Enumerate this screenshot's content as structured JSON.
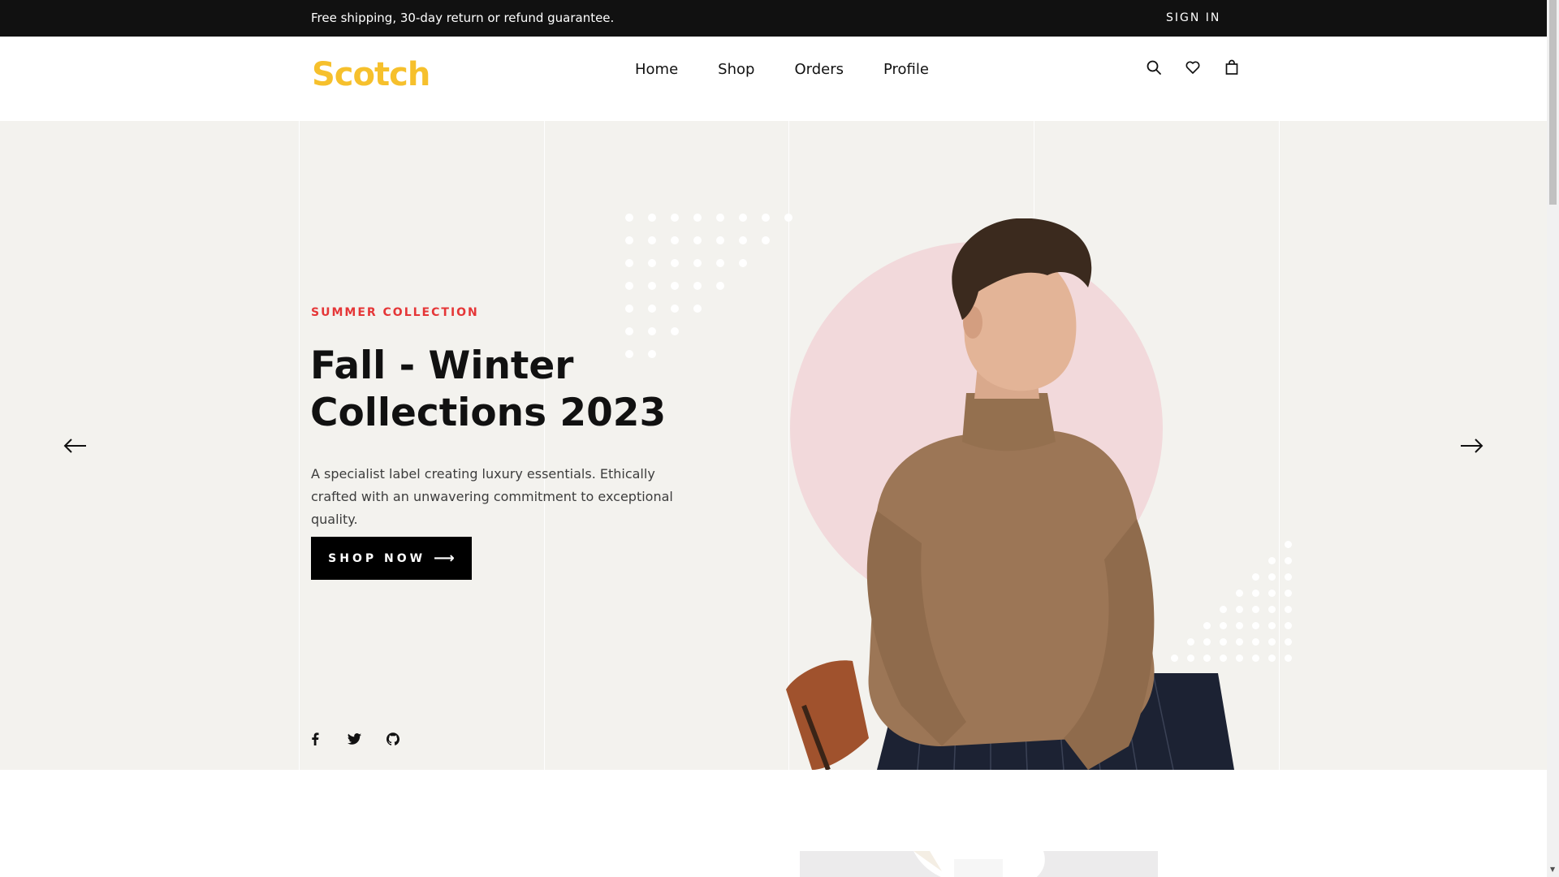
{
  "topbar": {
    "shipping_text": "Free shipping, 30-day return or refund guarantee.",
    "signin_label": "SIGN IN"
  },
  "header": {
    "logo_text": "Scotch",
    "nav": [
      "Home",
      "Shop",
      "Orders",
      "Profile"
    ],
    "icons": [
      "search-icon",
      "heart-icon",
      "shopping-bag-icon"
    ]
  },
  "hero": {
    "tag": "SUMMER COLLECTION",
    "title": "Fall - Winter Collections 2023",
    "description": "A specialist label creating luxury essentials. Ethically crafted with an unwavering commitment to exceptional quality.",
    "button_label": "SHOP NOW",
    "prev_icon": "arrow-left-icon",
    "next_icon": "arrow-right-icon",
    "social": [
      "facebook-icon",
      "twitter-icon",
      "github-icon"
    ]
  },
  "colors": {
    "accent_red": "#e53637",
    "logo_yellow": "#f6c02c",
    "hero_bg": "#f3f2ee",
    "circle_pink": "#f2d9db",
    "dark": "#111111"
  }
}
